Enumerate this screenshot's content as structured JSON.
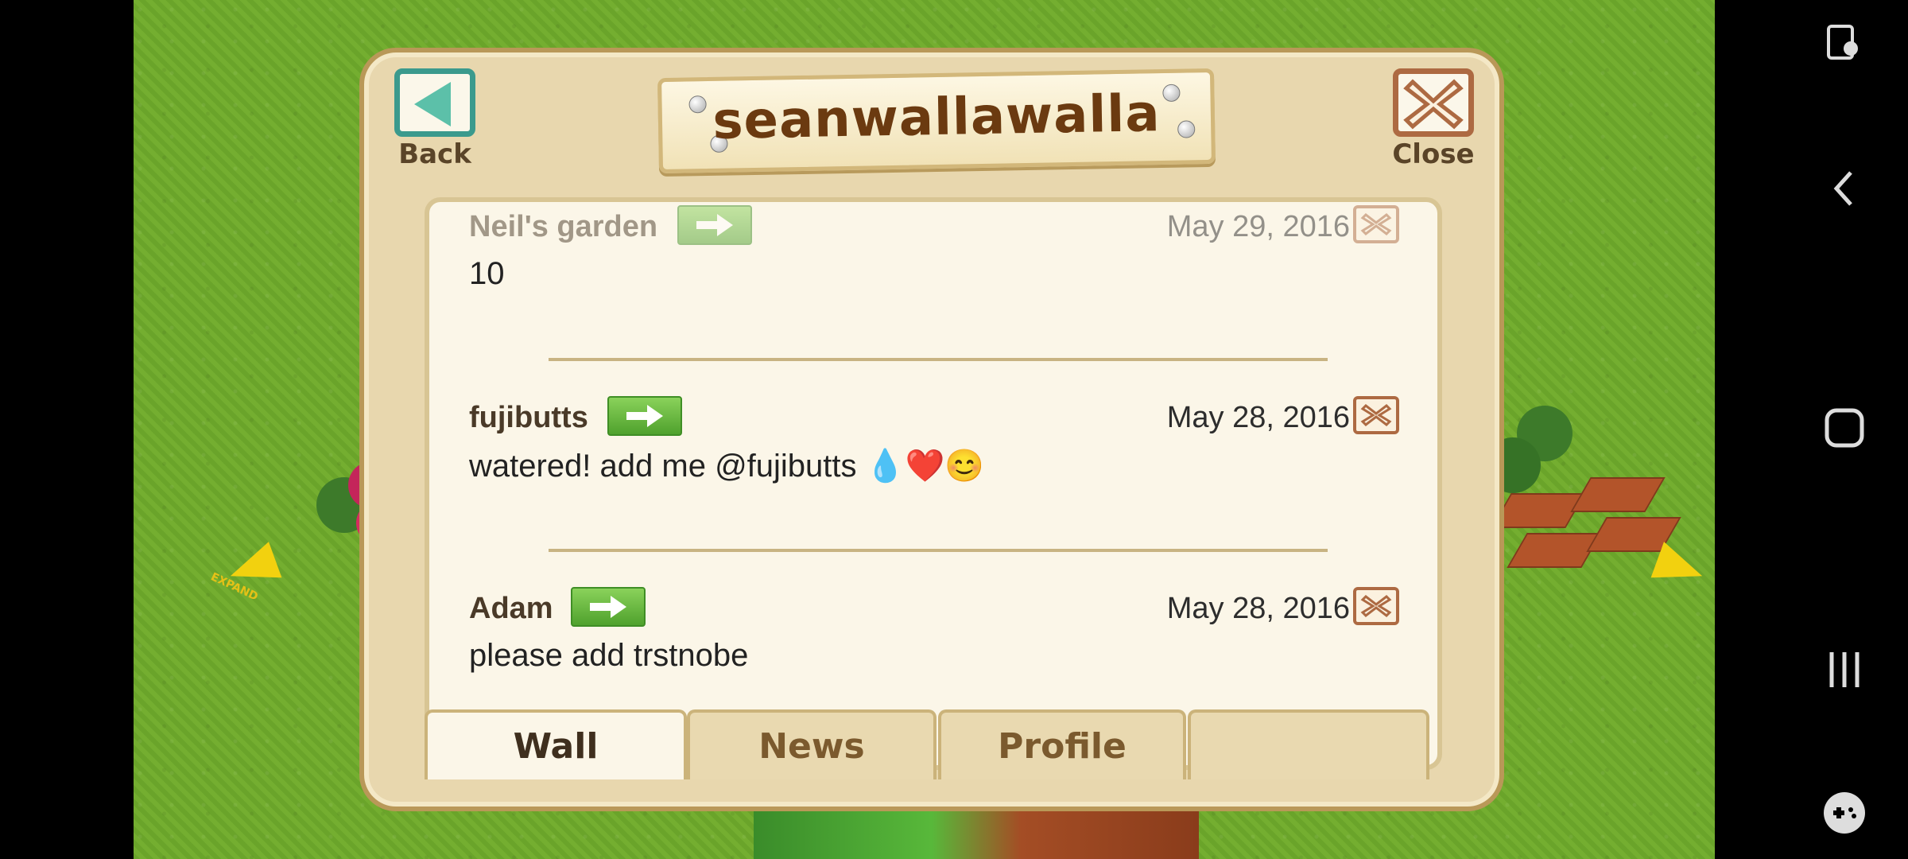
{
  "dialog": {
    "title": "seanwallawalla",
    "back_label": "Back",
    "close_label": "Close"
  },
  "posts": [
    {
      "author": "Neil's garden",
      "date": "May 29, 2016",
      "text": "10"
    },
    {
      "author": "fujibutts",
      "date": "May 28, 2016",
      "text": "watered! add me @fujibutts 💧❤️😊"
    },
    {
      "author": "Adam",
      "date": "May 28, 2016",
      "text": "please add trstnobe"
    }
  ],
  "tabs": [
    {
      "label": "Wall",
      "active": true
    },
    {
      "label": "News",
      "active": false
    },
    {
      "label": "Profile",
      "active": false
    },
    {
      "label": "",
      "active": false
    }
  ],
  "game": {
    "expand_label": "EXPAND",
    "grass_color": "#6fa82c"
  },
  "nav_icons": [
    "screen-touch-icon",
    "back-nav-icon",
    "home-nav-icon",
    "recent-apps-icon",
    "game-tools-icon"
  ]
}
